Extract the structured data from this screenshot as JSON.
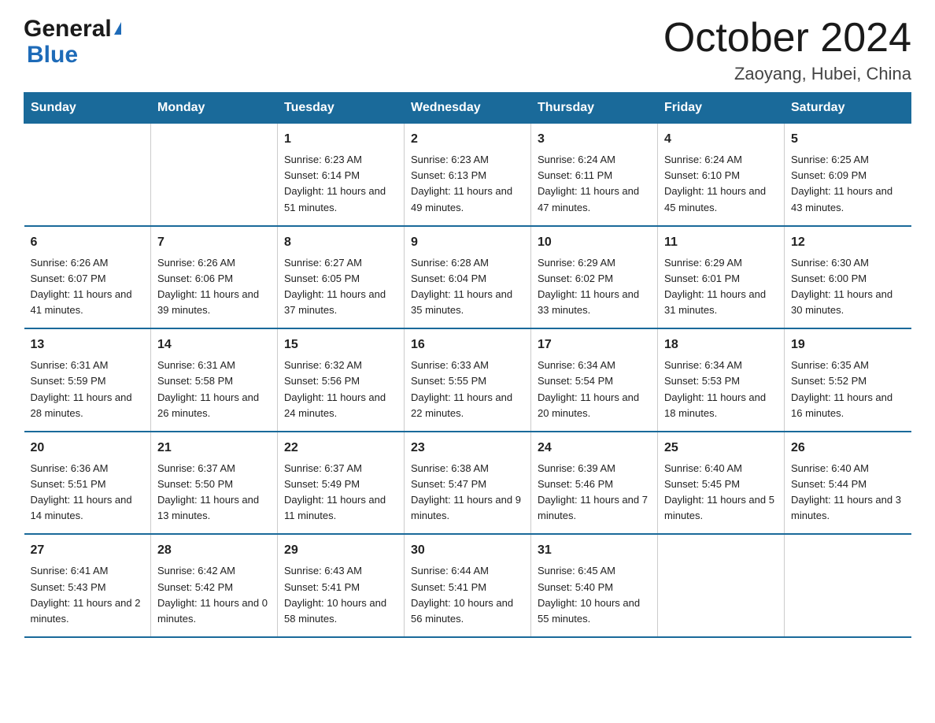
{
  "logo": {
    "general": "General",
    "arrow": "▶",
    "blue": "Blue"
  },
  "title": "October 2024",
  "location": "Zaoyang, Hubei, China",
  "days_header": [
    "Sunday",
    "Monday",
    "Tuesday",
    "Wednesday",
    "Thursday",
    "Friday",
    "Saturday"
  ],
  "weeks": [
    [
      {
        "day": "",
        "sunrise": "",
        "sunset": "",
        "daylight": ""
      },
      {
        "day": "",
        "sunrise": "",
        "sunset": "",
        "daylight": ""
      },
      {
        "day": "1",
        "sunrise": "Sunrise: 6:23 AM",
        "sunset": "Sunset: 6:14 PM",
        "daylight": "Daylight: 11 hours and 51 minutes."
      },
      {
        "day": "2",
        "sunrise": "Sunrise: 6:23 AM",
        "sunset": "Sunset: 6:13 PM",
        "daylight": "Daylight: 11 hours and 49 minutes."
      },
      {
        "day": "3",
        "sunrise": "Sunrise: 6:24 AM",
        "sunset": "Sunset: 6:11 PM",
        "daylight": "Daylight: 11 hours and 47 minutes."
      },
      {
        "day": "4",
        "sunrise": "Sunrise: 6:24 AM",
        "sunset": "Sunset: 6:10 PM",
        "daylight": "Daylight: 11 hours and 45 minutes."
      },
      {
        "day": "5",
        "sunrise": "Sunrise: 6:25 AM",
        "sunset": "Sunset: 6:09 PM",
        "daylight": "Daylight: 11 hours and 43 minutes."
      }
    ],
    [
      {
        "day": "6",
        "sunrise": "Sunrise: 6:26 AM",
        "sunset": "Sunset: 6:07 PM",
        "daylight": "Daylight: 11 hours and 41 minutes."
      },
      {
        "day": "7",
        "sunrise": "Sunrise: 6:26 AM",
        "sunset": "Sunset: 6:06 PM",
        "daylight": "Daylight: 11 hours and 39 minutes."
      },
      {
        "day": "8",
        "sunrise": "Sunrise: 6:27 AM",
        "sunset": "Sunset: 6:05 PM",
        "daylight": "Daylight: 11 hours and 37 minutes."
      },
      {
        "day": "9",
        "sunrise": "Sunrise: 6:28 AM",
        "sunset": "Sunset: 6:04 PM",
        "daylight": "Daylight: 11 hours and 35 minutes."
      },
      {
        "day": "10",
        "sunrise": "Sunrise: 6:29 AM",
        "sunset": "Sunset: 6:02 PM",
        "daylight": "Daylight: 11 hours and 33 minutes."
      },
      {
        "day": "11",
        "sunrise": "Sunrise: 6:29 AM",
        "sunset": "Sunset: 6:01 PM",
        "daylight": "Daylight: 11 hours and 31 minutes."
      },
      {
        "day": "12",
        "sunrise": "Sunrise: 6:30 AM",
        "sunset": "Sunset: 6:00 PM",
        "daylight": "Daylight: 11 hours and 30 minutes."
      }
    ],
    [
      {
        "day": "13",
        "sunrise": "Sunrise: 6:31 AM",
        "sunset": "Sunset: 5:59 PM",
        "daylight": "Daylight: 11 hours and 28 minutes."
      },
      {
        "day": "14",
        "sunrise": "Sunrise: 6:31 AM",
        "sunset": "Sunset: 5:58 PM",
        "daylight": "Daylight: 11 hours and 26 minutes."
      },
      {
        "day": "15",
        "sunrise": "Sunrise: 6:32 AM",
        "sunset": "Sunset: 5:56 PM",
        "daylight": "Daylight: 11 hours and 24 minutes."
      },
      {
        "day": "16",
        "sunrise": "Sunrise: 6:33 AM",
        "sunset": "Sunset: 5:55 PM",
        "daylight": "Daylight: 11 hours and 22 minutes."
      },
      {
        "day": "17",
        "sunrise": "Sunrise: 6:34 AM",
        "sunset": "Sunset: 5:54 PM",
        "daylight": "Daylight: 11 hours and 20 minutes."
      },
      {
        "day": "18",
        "sunrise": "Sunrise: 6:34 AM",
        "sunset": "Sunset: 5:53 PM",
        "daylight": "Daylight: 11 hours and 18 minutes."
      },
      {
        "day": "19",
        "sunrise": "Sunrise: 6:35 AM",
        "sunset": "Sunset: 5:52 PM",
        "daylight": "Daylight: 11 hours and 16 minutes."
      }
    ],
    [
      {
        "day": "20",
        "sunrise": "Sunrise: 6:36 AM",
        "sunset": "Sunset: 5:51 PM",
        "daylight": "Daylight: 11 hours and 14 minutes."
      },
      {
        "day": "21",
        "sunrise": "Sunrise: 6:37 AM",
        "sunset": "Sunset: 5:50 PM",
        "daylight": "Daylight: 11 hours and 13 minutes."
      },
      {
        "day": "22",
        "sunrise": "Sunrise: 6:37 AM",
        "sunset": "Sunset: 5:49 PM",
        "daylight": "Daylight: 11 hours and 11 minutes."
      },
      {
        "day": "23",
        "sunrise": "Sunrise: 6:38 AM",
        "sunset": "Sunset: 5:47 PM",
        "daylight": "Daylight: 11 hours and 9 minutes."
      },
      {
        "day": "24",
        "sunrise": "Sunrise: 6:39 AM",
        "sunset": "Sunset: 5:46 PM",
        "daylight": "Daylight: 11 hours and 7 minutes."
      },
      {
        "day": "25",
        "sunrise": "Sunrise: 6:40 AM",
        "sunset": "Sunset: 5:45 PM",
        "daylight": "Daylight: 11 hours and 5 minutes."
      },
      {
        "day": "26",
        "sunrise": "Sunrise: 6:40 AM",
        "sunset": "Sunset: 5:44 PM",
        "daylight": "Daylight: 11 hours and 3 minutes."
      }
    ],
    [
      {
        "day": "27",
        "sunrise": "Sunrise: 6:41 AM",
        "sunset": "Sunset: 5:43 PM",
        "daylight": "Daylight: 11 hours and 2 minutes."
      },
      {
        "day": "28",
        "sunrise": "Sunrise: 6:42 AM",
        "sunset": "Sunset: 5:42 PM",
        "daylight": "Daylight: 11 hours and 0 minutes."
      },
      {
        "day": "29",
        "sunrise": "Sunrise: 6:43 AM",
        "sunset": "Sunset: 5:41 PM",
        "daylight": "Daylight: 10 hours and 58 minutes."
      },
      {
        "day": "30",
        "sunrise": "Sunrise: 6:44 AM",
        "sunset": "Sunset: 5:41 PM",
        "daylight": "Daylight: 10 hours and 56 minutes."
      },
      {
        "day": "31",
        "sunrise": "Sunrise: 6:45 AM",
        "sunset": "Sunset: 5:40 PM",
        "daylight": "Daylight: 10 hours and 55 minutes."
      },
      {
        "day": "",
        "sunrise": "",
        "sunset": "",
        "daylight": ""
      },
      {
        "day": "",
        "sunrise": "",
        "sunset": "",
        "daylight": ""
      }
    ]
  ]
}
